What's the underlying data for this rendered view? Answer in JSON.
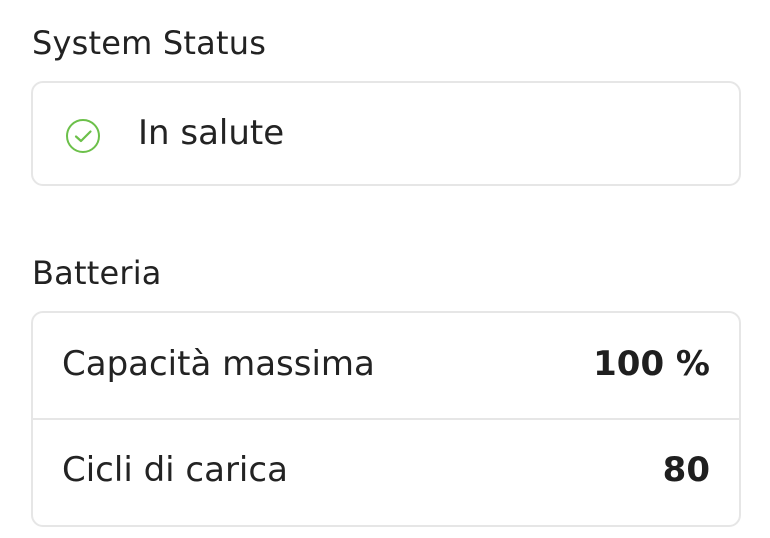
{
  "system_status": {
    "title": "System Status",
    "status_text": "In salute",
    "status_icon": "check-circle-icon",
    "status_color": "#6cc04a"
  },
  "battery": {
    "title": "Batteria",
    "rows": [
      {
        "label": "Capacità massima",
        "value": "100 %"
      },
      {
        "label": "Cicli di carica",
        "value": "80"
      }
    ]
  }
}
